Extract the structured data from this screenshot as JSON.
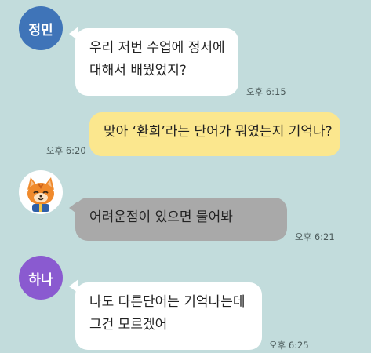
{
  "colors": {
    "background": "#c2dcdc",
    "bubble_white": "#ffffff",
    "bubble_yellow": "#fbe78e",
    "bubble_gray": "#a9a9a9",
    "avatar_jeongmin": "#3f74b8",
    "avatar_hana": "#8a5ad0"
  },
  "messages": [
    {
      "sender": "정민",
      "avatar_label": "정민",
      "lines": [
        "우리 저번 수업에 정서에",
        "대해서 배웠었지?"
      ],
      "time": "오후 6:15"
    },
    {
      "sender": "me",
      "lines": [
        "맞아 ‘환희’라는 단어가 뭐였는지 기억나?"
      ],
      "time": "오후 6:20"
    },
    {
      "sender": "mascot",
      "avatar_icon": "cat-mascot-icon",
      "lines": [
        "어려운점이 있으면 물어봐"
      ],
      "time": "오후 6:21"
    },
    {
      "sender": "하나",
      "avatar_label": "하나",
      "lines": [
        "나도 다른단어는 기억나는데",
        "그건 모르겠어"
      ],
      "time": "오후 6:25"
    }
  ]
}
